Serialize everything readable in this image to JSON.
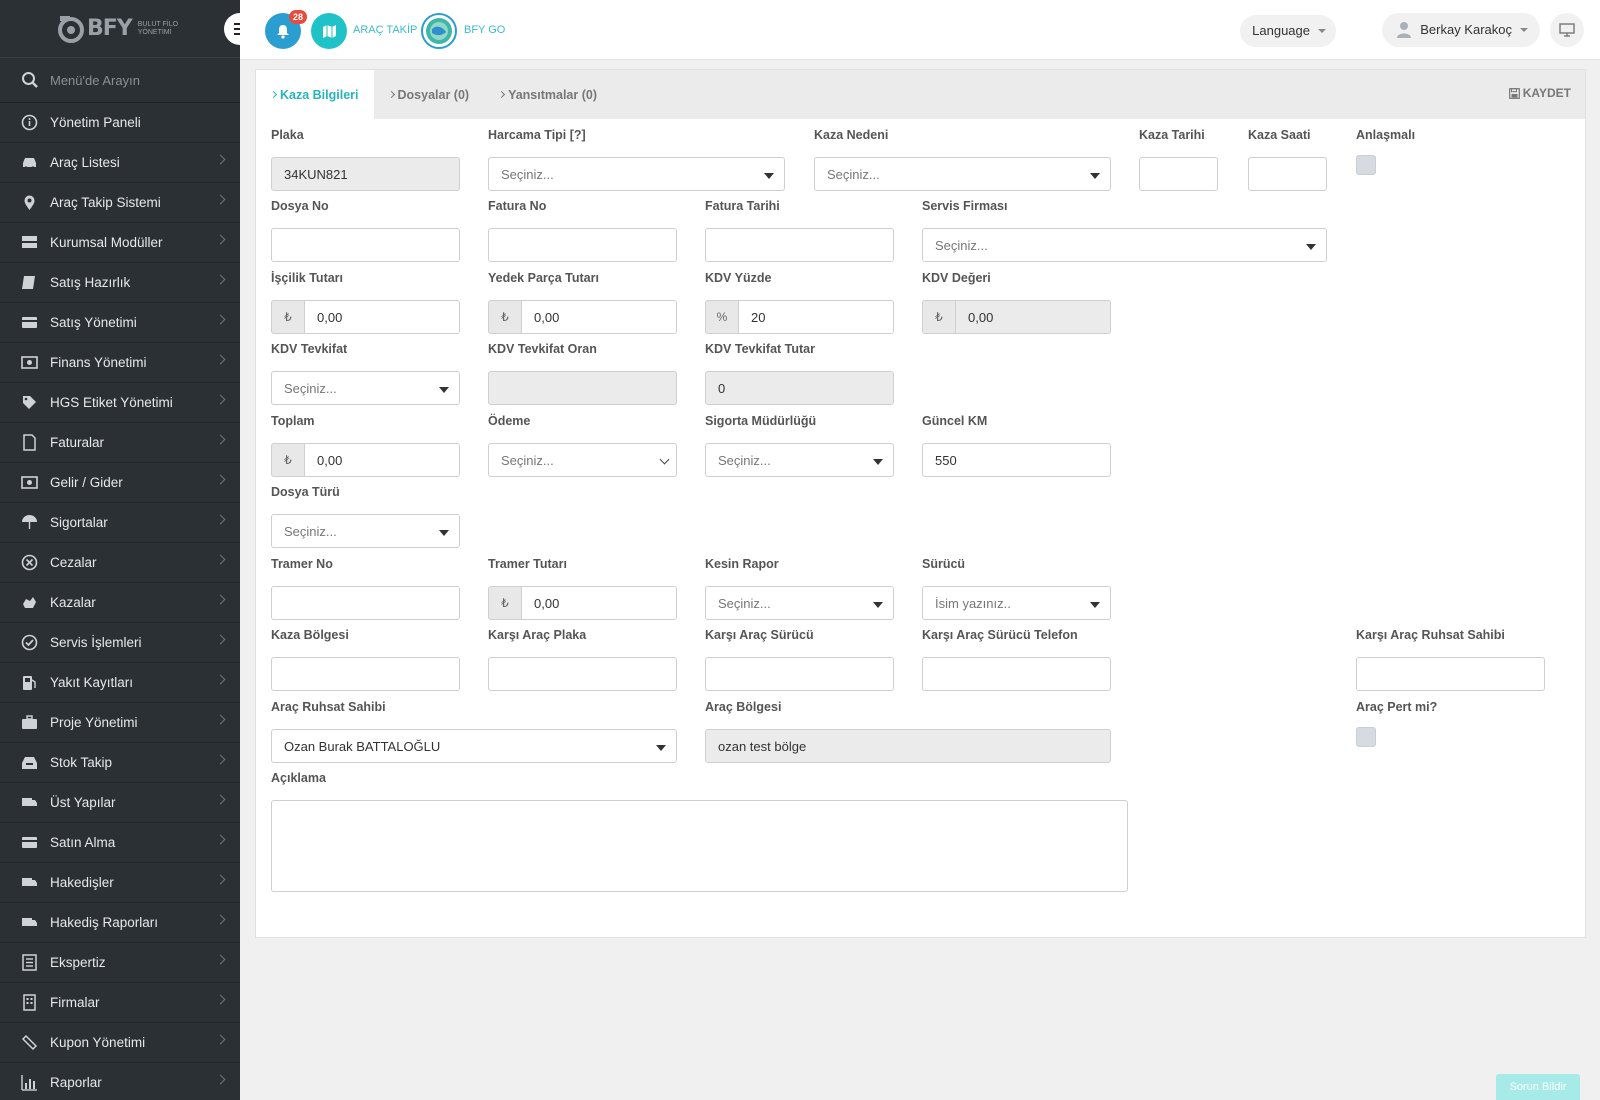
{
  "brand": {
    "name": "BFY",
    "sub1": "BULUT FİLO",
    "sub2": "YÖNETİMİ"
  },
  "sidebar": {
    "search_placeholder": "Menü'de Arayın",
    "items": [
      {
        "label": "Yönetim Paneli",
        "icon": "info-icon"
      },
      {
        "label": "Araç Listesi",
        "icon": "car-icon"
      },
      {
        "label": "Araç Takip Sistemi",
        "icon": "map-pin-icon"
      },
      {
        "label": "Kurumsal Modüller",
        "icon": "server-icon"
      },
      {
        "label": "Satış Hazırlık",
        "icon": "book-icon"
      },
      {
        "label": "Satış Yönetimi",
        "icon": "card-icon"
      },
      {
        "label": "Finans Yönetimi",
        "icon": "money-icon"
      },
      {
        "label": "HGS Etiket Yönetimi",
        "icon": "tag-icon"
      },
      {
        "label": "Faturalar",
        "icon": "file-icon"
      },
      {
        "label": "Gelir / Gider",
        "icon": "money-icon"
      },
      {
        "label": "Sigortalar",
        "icon": "umbrella-icon"
      },
      {
        "label": "Cezalar",
        "icon": "circle-x-icon"
      },
      {
        "label": "Kazalar",
        "icon": "crash-icon"
      },
      {
        "label": "Servis İşlemleri",
        "icon": "check-circle-icon"
      },
      {
        "label": "Yakıt Kayıtları",
        "icon": "fuel-icon"
      },
      {
        "label": "Proje Yönetimi",
        "icon": "briefcase-icon"
      },
      {
        "label": "Stok Takip",
        "icon": "inbox-icon"
      },
      {
        "label": "Üst Yapılar",
        "icon": "truck-icon"
      },
      {
        "label": "Satın Alma",
        "icon": "card-icon"
      },
      {
        "label": "Hakedişler",
        "icon": "truck-icon"
      },
      {
        "label": "Hakediş Raporları",
        "icon": "truck-icon"
      },
      {
        "label": "Ekspertiz",
        "icon": "list-icon"
      },
      {
        "label": "Firmalar",
        "icon": "building-icon"
      },
      {
        "label": "Kupon Yönetimi",
        "icon": "ticket-icon"
      },
      {
        "label": "Raporlar",
        "icon": "bar-chart-icon"
      }
    ]
  },
  "topbar": {
    "notification_count": "28",
    "arac_takip": "ARAÇ TAKİP",
    "bfy_go": "BFY GO",
    "language": "Language",
    "user_name": "Berkay Karakoç"
  },
  "tabs": [
    {
      "label": "Kaza Bilgileri"
    },
    {
      "label": "Dosyalar (0)"
    },
    {
      "label": "Yansıtmalar (0)"
    }
  ],
  "save_label": "KAYDET",
  "form": {
    "plaka": {
      "label": "Plaka",
      "value": "34KUN821"
    },
    "harcama_tipi": {
      "label": "Harcama Tipi [?]",
      "value": "Seçiniz..."
    },
    "kaza_nedeni": {
      "label": "Kaza Nedeni",
      "value": "Seçiniz..."
    },
    "kaza_tarihi": {
      "label": "Kaza Tarihi",
      "value": ""
    },
    "kaza_saati": {
      "label": "Kaza Saati",
      "value": ""
    },
    "anlasmali": {
      "label": "Anlaşmalı"
    },
    "dosya_no": {
      "label": "Dosya No",
      "value": ""
    },
    "fatura_no": {
      "label": "Fatura No",
      "value": ""
    },
    "fatura_tarihi": {
      "label": "Fatura Tarihi",
      "value": ""
    },
    "servis_firmasi": {
      "label": "Servis Firması",
      "value": "Seçiniz..."
    },
    "iscilik_tutari": {
      "label": "İşçilik Tutarı",
      "addon": "₺",
      "value": "0,00"
    },
    "yedek_parca_tutari": {
      "label": "Yedek Parça Tutarı",
      "addon": "₺",
      "value": "0,00"
    },
    "kdv_yuzde": {
      "label": "KDV Yüzde",
      "addon": "%",
      "value": "20"
    },
    "kdv_degeri": {
      "label": "KDV Değeri",
      "addon": "₺",
      "value": "0,00"
    },
    "kdv_tevkifat": {
      "label": "KDV Tevkifat",
      "value": "Seçiniz..."
    },
    "kdv_tevkifat_oran": {
      "label": "KDV Tevkifat Oran",
      "value": ""
    },
    "kdv_tevkifat_tutar": {
      "label": "KDV Tevkifat Tutar",
      "value": "0"
    },
    "toplam": {
      "label": "Toplam",
      "addon": "₺",
      "value": "0,00"
    },
    "odeme": {
      "label": "Ödeme",
      "value": "Seçiniz..."
    },
    "sigorta_mudurlugu": {
      "label": "Sigorta Müdürlüğü",
      "value": "Seçiniz..."
    },
    "guncel_km": {
      "label": "Güncel KM",
      "value": "550"
    },
    "dosya_turu": {
      "label": "Dosya Türü",
      "value": "Seçiniz..."
    },
    "tramer_no": {
      "label": "Tramer No",
      "value": ""
    },
    "tramer_tutari": {
      "label": "Tramer Tutarı",
      "addon": "₺",
      "value": "0,00"
    },
    "kesin_rapor": {
      "label": "Kesin Rapor",
      "value": "Seçiniz..."
    },
    "surucu": {
      "label": "Sürücü",
      "value": "İsim yazınız.."
    },
    "kaza_bolgesi": {
      "label": "Kaza Bölgesi",
      "value": ""
    },
    "karsi_arac_plaka": {
      "label": "Karşı Araç Plaka",
      "value": ""
    },
    "karsi_arac_surucu": {
      "label": "Karşı Araç Sürücü",
      "value": ""
    },
    "karsi_arac_surucu_telefon": {
      "label": "Karşı Araç Sürücü Telefon",
      "value": ""
    },
    "karsi_arac_ruhsat_sahibi": {
      "label": "Karşı Araç Ruhsat Sahibi",
      "value": ""
    },
    "arac_ruhsat_sahibi": {
      "label": "Araç Ruhsat Sahibi",
      "value": "Ozan Burak BATTALOĞLU"
    },
    "arac_bolgesi": {
      "label": "Araç Bölgesi",
      "value": "ozan test bölge"
    },
    "arac_pert_mi": {
      "label": "Araç Pert mi?"
    },
    "aciklama": {
      "label": "Açıklama",
      "value": ""
    }
  },
  "report_button": "Sorun Bildir",
  "colors": {
    "accent": "#27b5b8",
    "sidebar_bg": "#2b3035",
    "badge": "#e74c3c"
  }
}
